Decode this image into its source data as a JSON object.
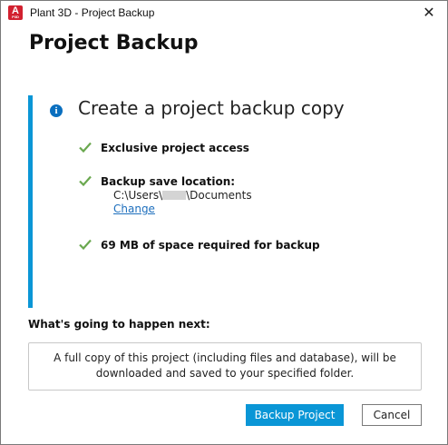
{
  "window": {
    "title": "Plant 3D - Project Backup",
    "app_icon_letter": "A",
    "app_icon_sub": "P3D",
    "close_glyph": "✕"
  },
  "page_title": "Project Backup",
  "panel": {
    "accent_color": "#0a96d6",
    "info_glyph": "i",
    "heading": "Create a project backup copy",
    "items": [
      {
        "label": "Exclusive project access",
        "status": "check-icon"
      },
      {
        "label": "Backup save location:",
        "status": "check-icon"
      },
      {
        "label": "69 MB of space required for backup",
        "status": "check-icon"
      }
    ],
    "path_prefix": "C:\\Users\\",
    "path_suffix": "\\Documents",
    "change_link": "Change",
    "check_color": "#6aa84f"
  },
  "next": {
    "label": "What's going to happen next:",
    "description": "A full copy of this project (including files and database), will be downloaded and saved to your specified folder."
  },
  "buttons": {
    "primary": "Backup Project",
    "secondary": "Cancel"
  }
}
